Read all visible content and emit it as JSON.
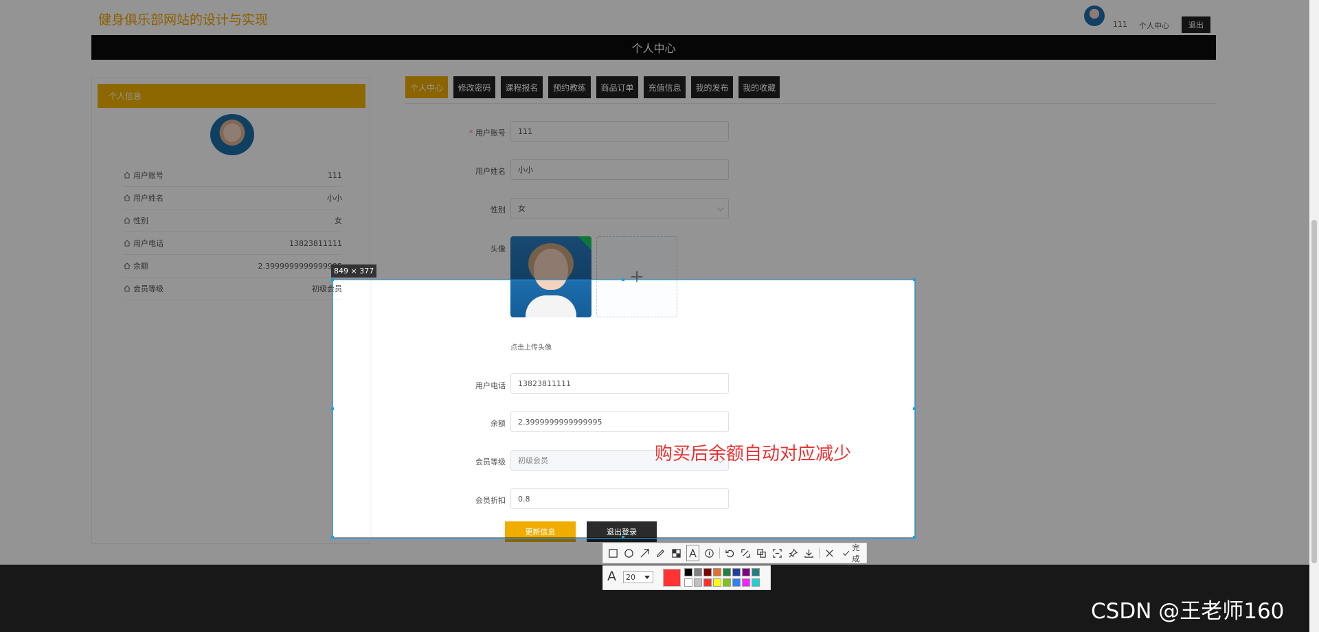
{
  "header": {
    "site_title": "健身俱乐部网站的设计与实现",
    "username": "111",
    "personal_center": "个人中心",
    "logout": "退出",
    "banner": "个人中心"
  },
  "profile_card": {
    "title": "个人信息",
    "rows": [
      {
        "label": "用户账号",
        "value": "111"
      },
      {
        "label": "用户姓名",
        "value": "小小"
      },
      {
        "label": "性别",
        "value": "女"
      },
      {
        "label": "用户电话",
        "value": "13823811111"
      },
      {
        "label": "余额",
        "value": "2.3999999999999995"
      },
      {
        "label": "会员等级",
        "value": "初级会员"
      }
    ]
  },
  "tabs": [
    "个人中心",
    "修改密码",
    "课程报名",
    "预约教练",
    "商品订单",
    "充值信息",
    "我的发布",
    "我的收藏"
  ],
  "form": {
    "account_label": "用户账号",
    "account_required": "*",
    "account_value": "111",
    "name_label": "用户姓名",
    "name_value": "小小",
    "gender_label": "性别",
    "gender_value": "女",
    "avatar_label": "头像",
    "upload_plus": "+",
    "upload_hint": "点击上传头像",
    "phone_label": "用户电话",
    "phone_value": "13823811111",
    "balance_label": "余额",
    "balance_value": "2.3999999999999995",
    "level_label": "会员等级",
    "level_value": "初级会员",
    "discount_label": "会员折扣",
    "discount_value": "0.8",
    "update_button": "更新信息",
    "logout_button": "退出登录"
  },
  "annotation": "购买后余额自动对应减少",
  "screenshot_tool": {
    "size_badge": "849 × 377",
    "done_label": "完成",
    "font_size": "20",
    "font_icon": "A",
    "current_color": "#ff3333",
    "palette": [
      "#000000",
      "#808080",
      "#800000",
      "#e07030",
      "#208040",
      "#2040a0",
      "#800080",
      "#208080",
      "#ffffff",
      "#c0c0c0",
      "#ff3030",
      "#ffff00",
      "#80c020",
      "#3080ff",
      "#ff20ff",
      "#20d0d0"
    ]
  },
  "watermark": "CSDN @王老师160"
}
